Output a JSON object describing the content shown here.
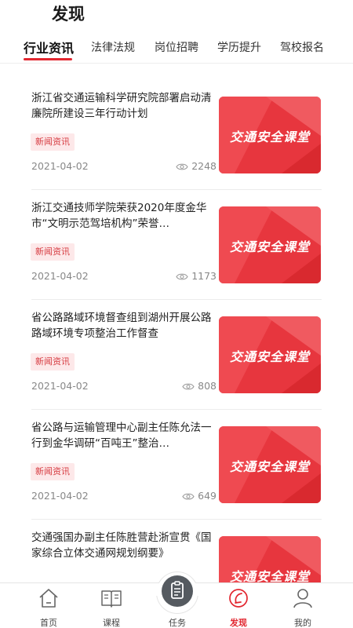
{
  "header": {
    "title": "发现"
  },
  "tabs": [
    {
      "label": "行业资讯",
      "active": true
    },
    {
      "label": "法律法规",
      "active": false
    },
    {
      "label": "岗位招聘",
      "active": false
    },
    {
      "label": "学历提升",
      "active": false
    },
    {
      "label": "驾校报名",
      "active": false
    }
  ],
  "articles": [
    {
      "title": "浙江省交通运输科学研究院部署启动清廉院所建设三年行动计划",
      "tag": "新闻资讯",
      "date": "2021-04-02",
      "views": "2248",
      "thumb_text": "交通安全课堂"
    },
    {
      "title": "浙江交通技师学院荣获2020年度金华市“文明示范驾培机构”荣誉…",
      "tag": "新闻资讯",
      "date": "2021-04-02",
      "views": "1173",
      "thumb_text": "交通安全课堂"
    },
    {
      "title": "省公路路域环境督查组到湖州开展公路路域环境专项整治工作督查",
      "tag": "新闻资讯",
      "date": "2021-04-02",
      "views": "808",
      "thumb_text": "交通安全课堂"
    },
    {
      "title": "省公路与运输管理中心副主任陈允法一行到金华调研“百吨王”整治…",
      "tag": "新闻资讯",
      "date": "2021-04-02",
      "views": "649",
      "thumb_text": "交通安全课堂"
    },
    {
      "title": "交通强国办副主任陈胜营赴浙宣贯《国家综合立体交通网规划纲要》",
      "tag": "",
      "date": "",
      "views": "",
      "thumb_text": "交通安全课堂"
    }
  ],
  "bottom_nav": [
    {
      "label": "首页",
      "icon": "home-icon",
      "active": false
    },
    {
      "label": "课程",
      "icon": "book-icon",
      "active": false
    },
    {
      "label": "任务",
      "icon": "task-icon",
      "active": false
    },
    {
      "label": "发现",
      "icon": "compass-icon",
      "active": true
    },
    {
      "label": "我的",
      "icon": "user-icon",
      "active": false
    }
  ],
  "colors": {
    "accent": "#e2262f",
    "thumb_red": "#e7363e",
    "tag_bg": "#fde8e9",
    "meta_gray": "#888888"
  }
}
